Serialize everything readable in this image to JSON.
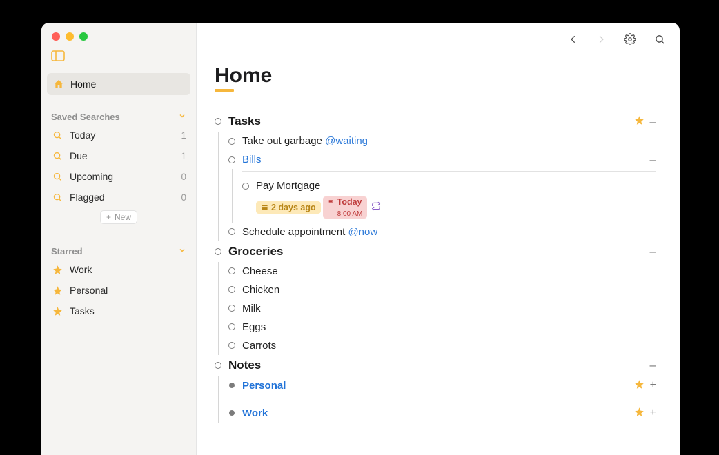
{
  "sidebar": {
    "home_label": "Home",
    "sections": {
      "saved_searches": {
        "title": "Saved Searches",
        "items": [
          {
            "label": "Today",
            "count": "1"
          },
          {
            "label": "Due",
            "count": "1"
          },
          {
            "label": "Upcoming",
            "count": "0"
          },
          {
            "label": "Flagged",
            "count": "0"
          }
        ],
        "new_label": "New"
      },
      "starred": {
        "title": "Starred",
        "items": [
          {
            "label": "Work"
          },
          {
            "label": "Personal"
          },
          {
            "label": "Tasks"
          }
        ]
      }
    }
  },
  "main": {
    "title": "Home",
    "outline": {
      "tasks": {
        "heading": "Tasks",
        "items": [
          {
            "text": "Take out garbage",
            "tag": "@waiting"
          },
          {
            "text": "Bills",
            "link": true
          },
          {
            "text": "Schedule appointment",
            "tag": "@now"
          }
        ],
        "bills_sub": {
          "text": "Pay Mortgage",
          "badge_date": "2 days ago",
          "badge_due": "Today",
          "badge_due_time": "8:00 AM"
        }
      },
      "groceries": {
        "heading": "Groceries",
        "items": [
          {
            "text": "Cheese"
          },
          {
            "text": "Chicken"
          },
          {
            "text": "Milk"
          },
          {
            "text": "Eggs"
          },
          {
            "text": "Carrots"
          }
        ]
      },
      "notes": {
        "heading": "Notes",
        "items": [
          {
            "text": "Personal"
          },
          {
            "text": "Work"
          }
        ]
      }
    }
  }
}
